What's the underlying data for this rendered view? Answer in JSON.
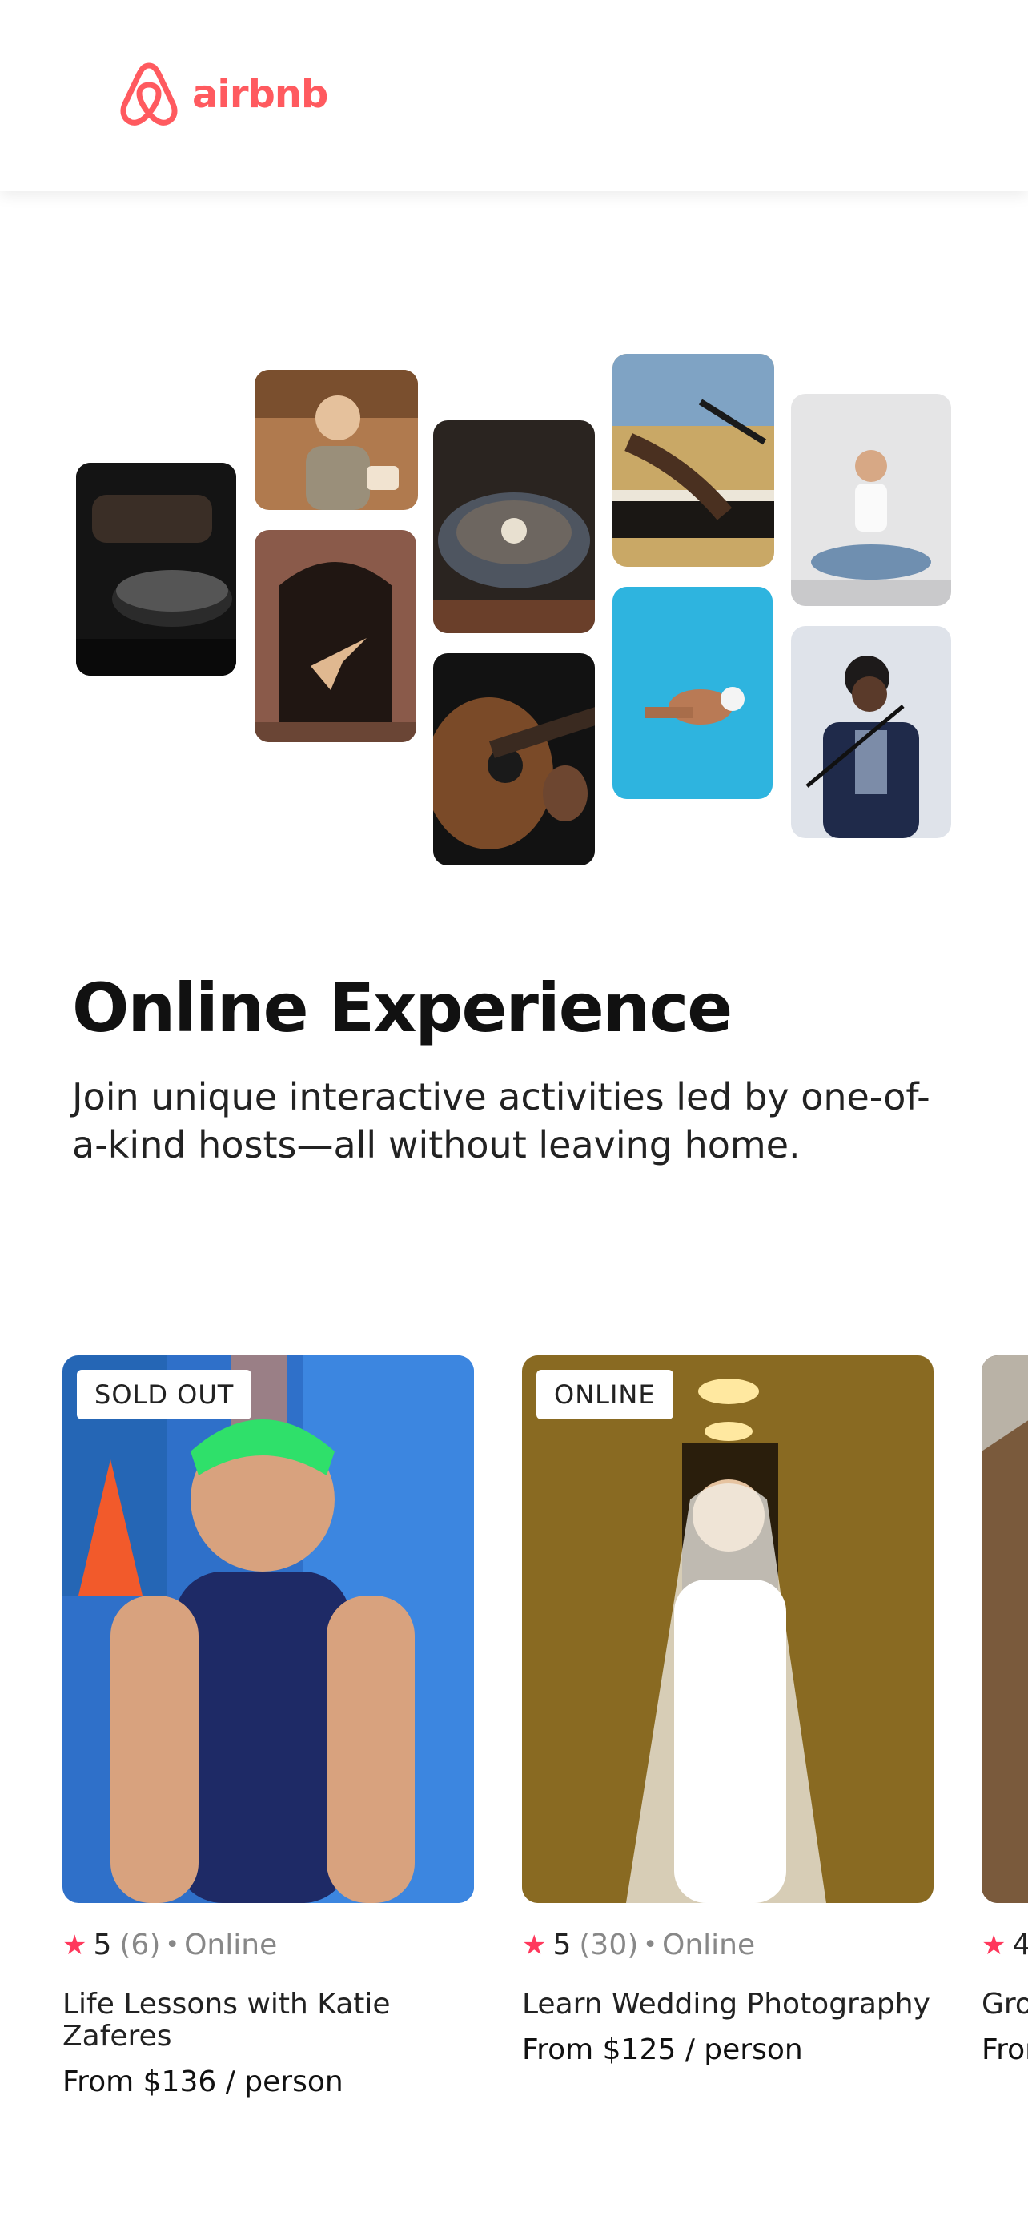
{
  "header": {
    "logo": {
      "icon": "airbnb-belo-icon",
      "text": "airbnb",
      "color": "#FF5A5F"
    }
  },
  "collage": {
    "tiles": [
      {
        "name": "cooking-pan-photo"
      },
      {
        "name": "baker-woman-photo"
      },
      {
        "name": "dancer-doorway-photo"
      },
      {
        "name": "plated-dish-photo"
      },
      {
        "name": "acoustic-guitar-photo"
      },
      {
        "name": "piano-microphone-photo"
      },
      {
        "name": "swimmer-pool-photo"
      },
      {
        "name": "yoga-meditation-photo"
      },
      {
        "name": "singer-microphone-photo"
      }
    ]
  },
  "main": {
    "title": "Online Experience",
    "subtitle": "Join unique interactive activities led by one-of-a-kind hosts—all without leaving home."
  },
  "cards": [
    {
      "badge": "SOLD OUT",
      "rating": "5",
      "reviews": "(6)",
      "separator": "•",
      "location": "Online",
      "title": "Life Lessons with Katie Zaferes",
      "price_prefix": "From",
      "price": "$136",
      "price_suffix": "/ person"
    },
    {
      "badge": "ONLINE",
      "rating": "5",
      "reviews": "(30)",
      "separator": "•",
      "location": "Online",
      "title": "Learn Wedding Photography",
      "price_prefix": "From",
      "price": "$125",
      "price_suffix": "/ person"
    },
    {
      "rating": "4",
      "title": "Gro",
      "price_prefix": "Fror"
    }
  ],
  "colors": {
    "accent": "#FF385C",
    "brand": "#FF5A5F"
  }
}
